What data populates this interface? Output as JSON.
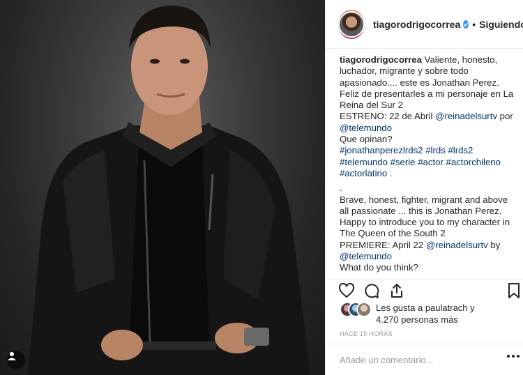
{
  "post": {
    "username": "tiagorodrigocorrea",
    "follow_status": "Siguiendo",
    "separator": "•"
  },
  "caption": {
    "username": "tiagorodrigocorrea",
    "line1": " Valiente, honesto, luchador, migrante y sobre todo apasionado.... este es Jonathan Perez.",
    "line2": "Feliz de presentarles a mi personaje en La Reina del Sur 2",
    "estreno_prefix": "ESTRENO: 22 de Abril ",
    "mention1": "@reinadelsurtv",
    "por": " por",
    "mention2": "@telemundo",
    "question_es": "Que opinan?",
    "hashtags": [
      "#jonathanperezlrds2",
      "#lrds",
      "#lrds2",
      "#telemundo",
      "#serie",
      "#actor",
      "#actorchileno",
      "#actorlatino"
    ],
    "hashtag_end": " .",
    "dot_line": ".",
    "en_line1": "Brave, honest, fighter, migrant and above all passionate ... this is Jonathan Perez.",
    "en_line2": "Happy to introduce you to my character in The Queen of the South 2",
    "premiere_prefix": "PREMIERE: April 22 ",
    "mention3": "@reinadelsurtv",
    "by": " by",
    "mention4": "@telemundo",
    "question_en": "What do you think?"
  },
  "likes": {
    "prefix": "Les gusta a ",
    "user": "paulatrach",
    "mid": " y",
    "count": "4.270 personas más"
  },
  "timestamp": "HACE 15 HORAS",
  "comment": {
    "placeholder": "Añade un comentario..."
  },
  "colors": {
    "link": "#003569",
    "verified": "#3897f0",
    "muted": "#999999",
    "text": "#262626"
  },
  "icons": [
    "heart-icon",
    "comment-icon",
    "share-icon",
    "bookmark-icon",
    "verified-icon",
    "user-tag-icon",
    "more-icon"
  ]
}
